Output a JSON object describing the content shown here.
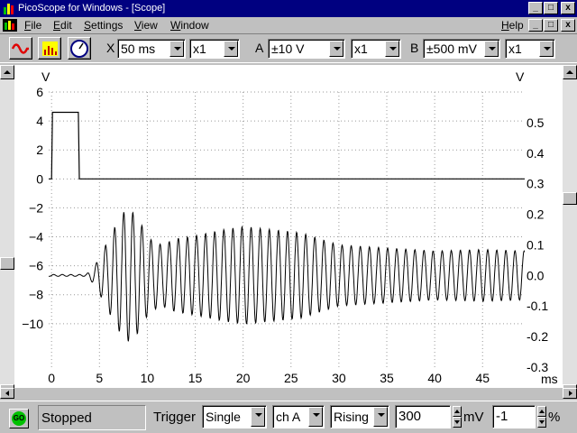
{
  "window": {
    "title": "PicoScope for Windows - [Scope]",
    "title_bar_color": "#000080",
    "buttons": {
      "minimize": "_",
      "maximize": "□",
      "close": "x"
    }
  },
  "menu": {
    "items": [
      {
        "label": "File",
        "underline": "F",
        "rest": "ile"
      },
      {
        "label": "Edit",
        "underline": "E",
        "rest": "dit"
      },
      {
        "label": "Settings",
        "underline": "S",
        "rest": "ettings"
      },
      {
        "label": "View",
        "underline": "V",
        "rest": "iew"
      },
      {
        "label": "Window",
        "underline": "W",
        "rest": "indow"
      }
    ],
    "help": {
      "label": "Help",
      "underline": "H",
      "rest": "elp"
    },
    "doc_buttons": {
      "minimize": "_",
      "maximize": "□",
      "close": "x"
    }
  },
  "toolbar": {
    "icons": [
      "scope-mode-icon",
      "spectrum-mode-icon",
      "meter-mode-icon"
    ],
    "x": {
      "label": "X",
      "timebase": "50 ms",
      "zoom": "x1"
    },
    "a": {
      "label": "A",
      "range": "±10 V",
      "zoom": "x1"
    },
    "b": {
      "label": "B",
      "range": "±500 mV",
      "zoom": "x1"
    }
  },
  "statusbar": {
    "go_label": "GO",
    "go_color": "#00c000",
    "status": "Stopped",
    "trigger_label": "Trigger",
    "trigger_mode": "Single",
    "trigger_channel": "ch A",
    "trigger_edge": "Rising",
    "trigger_level": "300",
    "trigger_level_unit": "mV",
    "pretrigger": "-1",
    "pretrigger_unit": "%"
  },
  "chart_data": {
    "type": "line",
    "title": "",
    "xlabel": "ms",
    "ylabel_left": "V",
    "ylabel_right": "V",
    "xlim": [
      -0.3,
      49.4
    ],
    "ylim_left": [
      -13,
      6
    ],
    "ylim_right": [
      -0.3,
      0.6
    ],
    "grid": true,
    "x_ticks": [
      0,
      5,
      10,
      15,
      20,
      25,
      30,
      35,
      40,
      45
    ],
    "y_left_ticks": [
      6,
      4,
      2,
      0,
      -2,
      -4,
      -6,
      -8,
      -10
    ],
    "y_right_ticks": [
      0.5,
      0.4,
      0.3,
      0.2,
      0.1,
      0.0,
      -0.1,
      -0.2,
      -0.3
    ],
    "y_right_tick_labels": [
      "0.5",
      "0.4",
      "0.3",
      "0.2",
      "0.1",
      "0.0",
      "-0.1",
      "-0.2",
      "-0.3"
    ],
    "series": [
      {
        "axis": "left",
        "color": "#000000",
        "points": [
          [
            -0.3,
            0
          ],
          [
            0.0,
            0
          ],
          [
            0.1,
            4.6
          ],
          [
            2.8,
            4.6
          ],
          [
            2.9,
            0
          ],
          [
            49.4,
            0
          ]
        ]
      },
      {
        "axis": "right",
        "color": "#000000",
        "baseline": 0.0,
        "oscillation_period_ms": 0.95,
        "onset_ms": 3.5,
        "envelope": [
          [
            -0.3,
            0.0
          ],
          [
            3.5,
            0.0
          ],
          [
            4.5,
            0.03
          ],
          [
            5.5,
            0.09
          ],
          [
            6.8,
            0.17
          ],
          [
            7.8,
            0.22
          ],
          [
            8.8,
            0.2
          ],
          [
            10.2,
            0.12
          ],
          [
            11.5,
            0.1
          ],
          [
            13,
            0.12
          ],
          [
            15,
            0.13
          ],
          [
            18,
            0.15
          ],
          [
            20,
            0.16
          ],
          [
            23,
            0.15
          ],
          [
            26,
            0.14
          ],
          [
            30,
            0.1
          ],
          [
            35,
            0.09
          ],
          [
            40,
            0.08
          ],
          [
            45,
            0.085
          ],
          [
            49.4,
            0.08
          ]
        ]
      }
    ]
  }
}
